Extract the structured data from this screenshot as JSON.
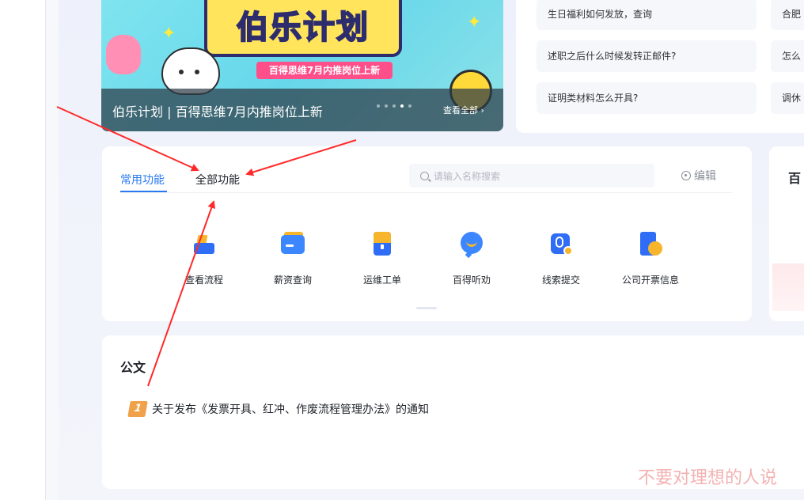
{
  "banner": {
    "sign_title": "伯乐计划",
    "tag": "百得思维7月内推岗位上新",
    "caption": "伯乐计划 | 百得思维7月内推岗位上新",
    "view_all": "查看全部 ›",
    "dot_count": 5,
    "active_dot": 4
  },
  "faq": {
    "left": [
      "生日福利如何发放，查询",
      "述职之后什么时候发转正邮件?",
      "证明类材料怎么开具?"
    ],
    "right": [
      "合肥",
      "怎么",
      "调休"
    ]
  },
  "functions": {
    "tabs": [
      "常用功能",
      "全部功能"
    ],
    "active_tab": "常用功能",
    "search_placeholder": "请输入名称搜索",
    "edit_label": "编辑",
    "items": [
      {
        "label": "查看流程",
        "icon": "process-icon"
      },
      {
        "label": "薪资查询",
        "icon": "salary-card-icon"
      },
      {
        "label": "运维工单",
        "icon": "ticket-icon"
      },
      {
        "label": "百得听劝",
        "icon": "chat-bubble-icon"
      },
      {
        "label": "线索提交",
        "icon": "clue-icon"
      },
      {
        "label": "公司开票信息",
        "icon": "invoice-icon"
      }
    ]
  },
  "right_card": {
    "title": "百"
  },
  "documents": {
    "title": "公文",
    "items": [
      {
        "rank": "1",
        "text": "关于发布《发票开具、红冲、作废流程管理办法》的通知"
      }
    ]
  },
  "watermark": "不要对理想的人说",
  "annotation": {
    "arrow_color": "#ff2a2a"
  }
}
